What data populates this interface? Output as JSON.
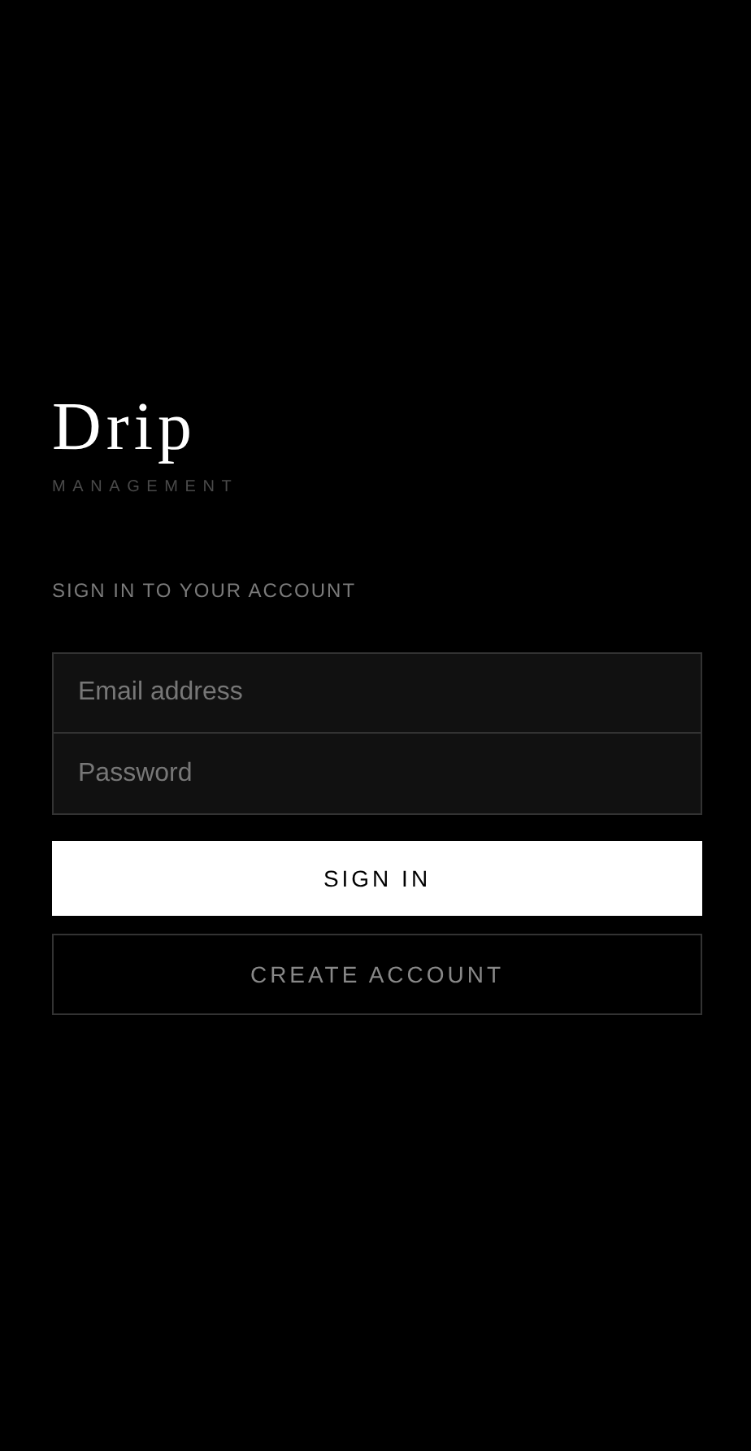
{
  "brand": {
    "name": "Drip",
    "tagline": "MANAGEMENT"
  },
  "heading": "SIGN IN TO YOUR ACCOUNT",
  "fields": [
    {
      "placeholder": "Email address"
    },
    {
      "placeholder": "Password"
    }
  ],
  "buttons": [
    {
      "label": "SIGN IN",
      "kind": "primary"
    },
    {
      "label": "CREATE ACCOUNT",
      "kind": "secondary"
    }
  ]
}
